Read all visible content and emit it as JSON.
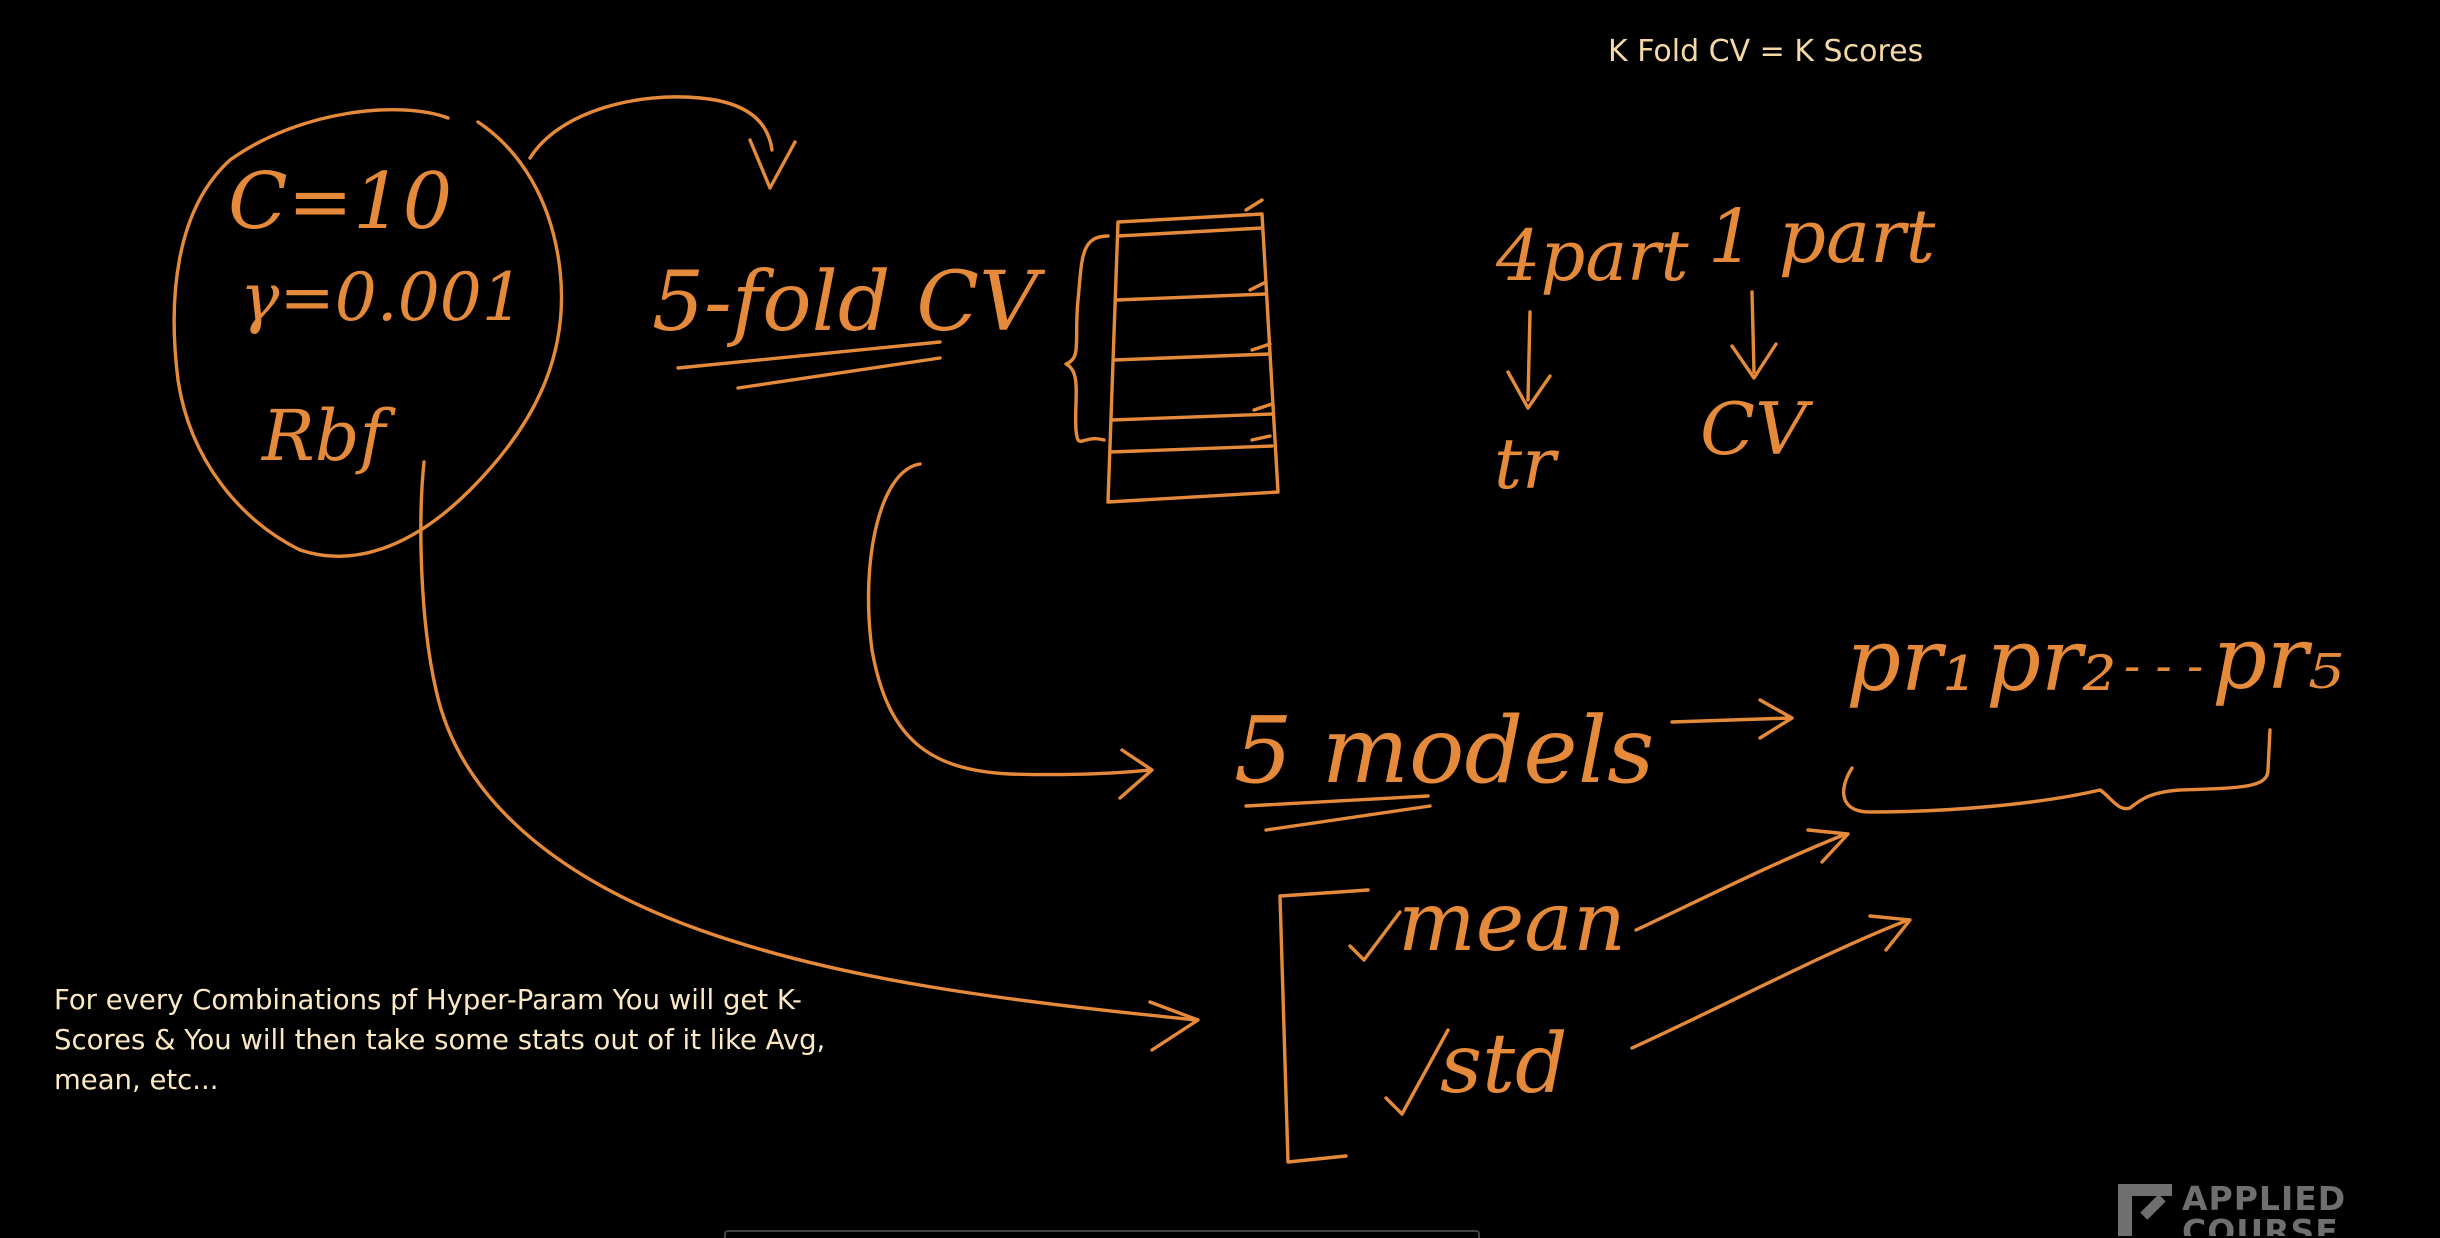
{
  "notes": {
    "top_right": "K Fold CV = K Scores",
    "bottom_left": "For every Combinations pf Hyper-Param You will get K-Scores & You will then take some stats out of it like Avg, mean, etc..."
  },
  "handwriting": {
    "c_value": "C=10",
    "gamma_value": "γ=0.001",
    "kernel": "Rbf",
    "five_fold_cv": "5-fold CV",
    "four_part": "4part",
    "one_part": "1 part",
    "tr": "tr",
    "cv": "CV",
    "five_models": "5 models",
    "pr1": "pr₁",
    "pr2": "pr₂",
    "dots": "- - -",
    "pr5": "pr₅",
    "mean": "mean",
    "std": "std"
  },
  "logo": {
    "text_line1": "APPLIED",
    "text_line2": "COURSE"
  },
  "colors": {
    "ink": "#e58a3a",
    "note_text": "#fbe9c4",
    "background": "#000000"
  }
}
